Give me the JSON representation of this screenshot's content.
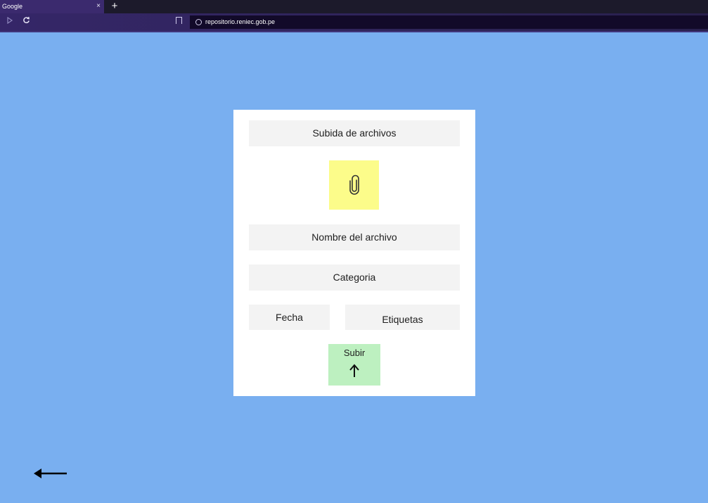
{
  "browser": {
    "tab_title": "Google",
    "tab_close": "×",
    "new_tab": "+",
    "url": "repositorio.reniec.gob.pe",
    "colors": {
      "tabbar": "#1c1a2b",
      "tab": "#3b2a6e",
      "toolbar": "#2e2458",
      "urlbar": "#120a29"
    }
  },
  "page": {
    "background": "#79aff0",
    "form": {
      "title": "Subida de archivos",
      "attach_icon": "paperclip-icon",
      "filename_label": "Nombre del archivo",
      "category_label": "Categoria",
      "date_label": "Fecha",
      "tags_label": "Etiquetas",
      "upload_label": "Subir",
      "upload_icon": "arrow-up-icon",
      "colors": {
        "card": "#ffffff",
        "field": "#f3f3f3",
        "attach": "#fcfc8a",
        "upload": "#bdf0c0"
      }
    },
    "back_icon": "arrow-left-icon"
  }
}
